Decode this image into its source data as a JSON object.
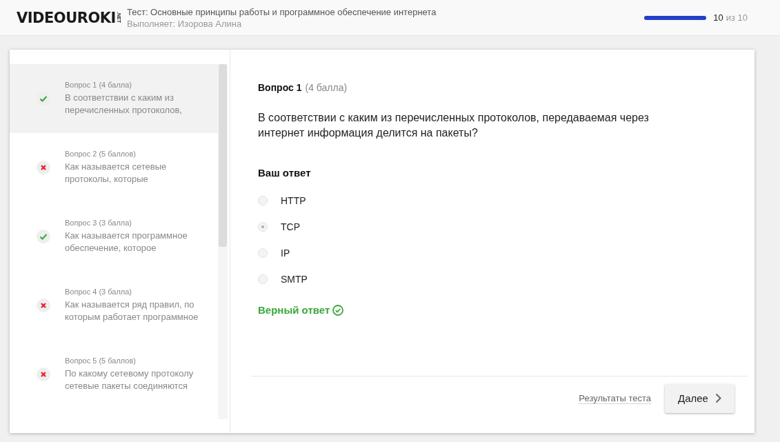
{
  "header": {
    "logo": "VIDEOUROKI",
    "logo_suffix": ".NET",
    "test_title": "Тест: Основные принципы работы и программное обеспечение интернета",
    "performer": "Выполняет: Изорова Алина",
    "progress": {
      "level": 1.0,
      "current": "10",
      "total": "из 10"
    }
  },
  "sidebar": {
    "items": [
      {
        "title": "Вопрос 1 (4 балла)",
        "text": "В соответствии с каким из перечисленных протоколов,",
        "correct": true,
        "selected": true
      },
      {
        "title": "Вопрос 2 (5 баллов)",
        "text": "Как называется сетевые протоколы, которые",
        "correct": false,
        "selected": false
      },
      {
        "title": "Вопрос 3 (3 балла)",
        "text": "Как называется программное обеспечение, которое",
        "correct": true,
        "selected": false
      },
      {
        "title": "Вопрос 4 (3 балла)",
        "text": "Как называется ряд правил, по которым работает программное",
        "correct": false,
        "selected": false
      },
      {
        "title": "Вопрос 5 (5 баллов)",
        "text": "По какому сетевому протоколу сетевые пакеты соединяются",
        "correct": false,
        "selected": false
      }
    ]
  },
  "question": {
    "number": "Вопрос 1",
    "points": "(4 балла)",
    "text": "В соответствии с каким из перечисленных протоколов, передаваемая через интернет информация делится на пакеты?",
    "answer_heading": "Ваш ответ",
    "options": [
      {
        "label": "HTTP",
        "selected": false
      },
      {
        "label": "TCP",
        "selected": true
      },
      {
        "label": "IP",
        "selected": false
      },
      {
        "label": "SMTP",
        "selected": false
      }
    ],
    "verdict": {
      "text": "Верный ответ",
      "correct": true
    }
  },
  "footer": {
    "results_link": "Результаты теста",
    "next_button": "Далее"
  }
}
